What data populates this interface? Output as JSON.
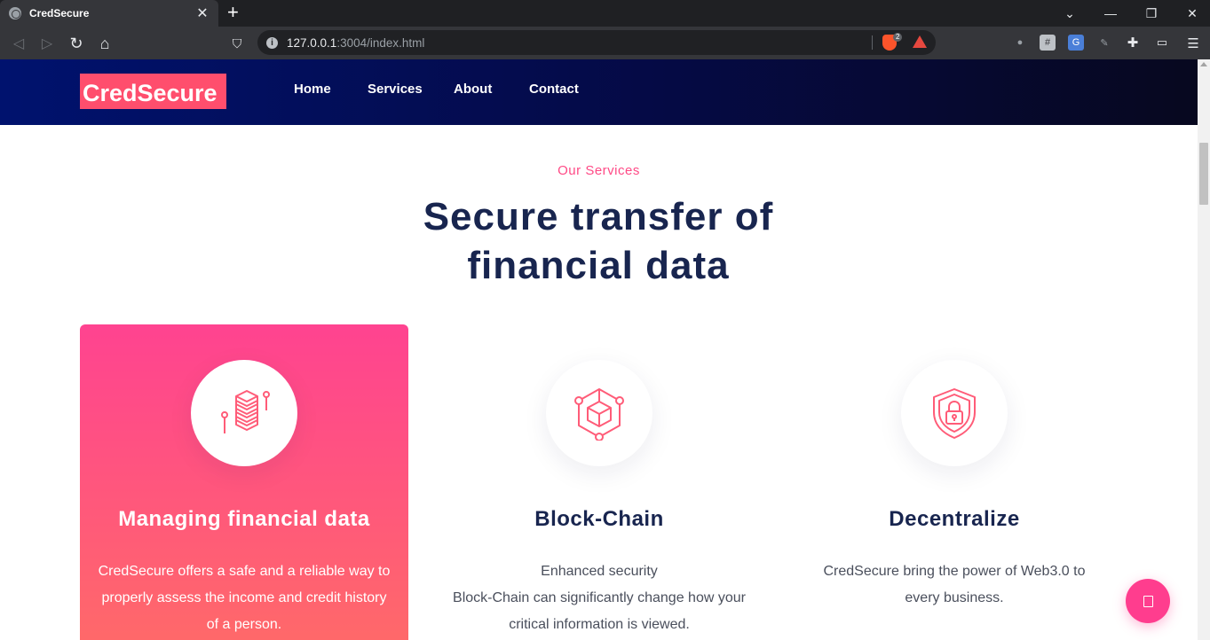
{
  "browser": {
    "tab_title": "CredSecure",
    "tab_close": "✕",
    "new_tab": "+",
    "url_host": "127.0.0.1",
    "url_rest": ":3004/index.html",
    "brave_badge": "2",
    "window_controls": {
      "minimize": "—",
      "restore": "❐",
      "close": "✕",
      "tabs_menu": "⌄"
    },
    "nav_glyphs": {
      "back": "◁",
      "forward": "▷",
      "reload": "↻",
      "home": "⌂",
      "bookmark": "⛉",
      "menu": "☰"
    }
  },
  "site": {
    "logo": "CredSecure",
    "nav": [
      "Home",
      "Services",
      "About",
      "Contact"
    ],
    "eyebrow": "Our Services",
    "headline_line1": "Secure transfer of",
    "headline_line2": "financial data",
    "services": [
      {
        "title": "Managing financial data",
        "text": "CredSecure offers a safe and a reliable way to properly assess the income and credit history of a person.",
        "icon": "stacked-data-icon",
        "active": true
      },
      {
        "title": "Block-Chain",
        "text_line1": "Enhanced security",
        "text_line2": "Block-Chain can significantly change how your critical information is viewed.",
        "icon": "blockchain-cube-icon",
        "active": false
      },
      {
        "title": "Decentralize",
        "text": "CredSecure bring the power of Web3.0 to every business.",
        "icon": "shield-lock-icon",
        "active": false
      }
    ]
  },
  "colors": {
    "accent_pink": "#ff4a86",
    "navy": "#18254f",
    "navbar_start": "#00126e",
    "navbar_end": "#07081f",
    "logo_bg": "#ff4e6d"
  }
}
